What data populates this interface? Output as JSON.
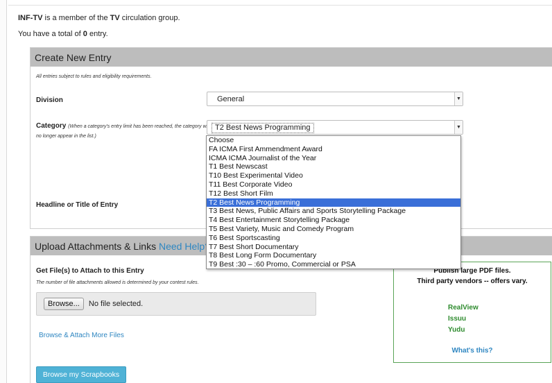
{
  "membership": {
    "org": "INF-TV",
    "middle": " is a member of the ",
    "group": "TV",
    "tail": " circulation group."
  },
  "entry_count": {
    "prefix": "You have a total of ",
    "count": "0",
    "suffix": " entry."
  },
  "create_panel": {
    "title": "Create New Entry",
    "eligibility": "All entries subject to rules and eligibility requirements.",
    "division_label": "Division",
    "division_value": "General",
    "category_label": "Category",
    "category_note": "(When a category's entry limit has been reached, the category will no longer appear in the list.)",
    "category_value": "T2 Best News Programming",
    "headline_label": "Headline or Title of Entry"
  },
  "category_options": [
    "Choose",
    "FA ICMA First Ammendment Award",
    "ICMA ICMA Journalist of the Year",
    "T1 Best Newscast",
    "T10 Best Experimental Video",
    "T11 Best Corporate Video",
    "T12 Best Short Film",
    "T2 Best News Programming",
    "T3 Best News, Public Affairs and Sports Storytelling Package",
    "T4 Best Entertainment Storytelling Package",
    "T5 Best Variety, Music and Comedy Program",
    "T6 Best Sportscasting",
    "T7 Best Short Documentary",
    "T8 Best Long Form Documentary",
    "T9 Best :30 – :60 Promo, Commercial or PSA"
  ],
  "selected_index": 7,
  "upload_panel": {
    "title": "Upload Attachments & Links",
    "help_link": "Need Help?",
    "get_files_label": "Get File(s) to Attach to this Entry",
    "file_limit_note": "The number of file attachments allowed is determined by your contest rules.",
    "browse_button": "Browse...",
    "no_file_text": "No file selected.",
    "browse_more": "Browse & Attach More Files",
    "scrapbooks_button": "Browse my Scrapbooks"
  },
  "vendor_box": {
    "line1": "Publish large PDF files.",
    "line2": "Third party vendors  --  offers vary.",
    "vendors": [
      "RealView",
      "Issuu",
      "Yudu"
    ],
    "whats_this": "What's this?"
  }
}
